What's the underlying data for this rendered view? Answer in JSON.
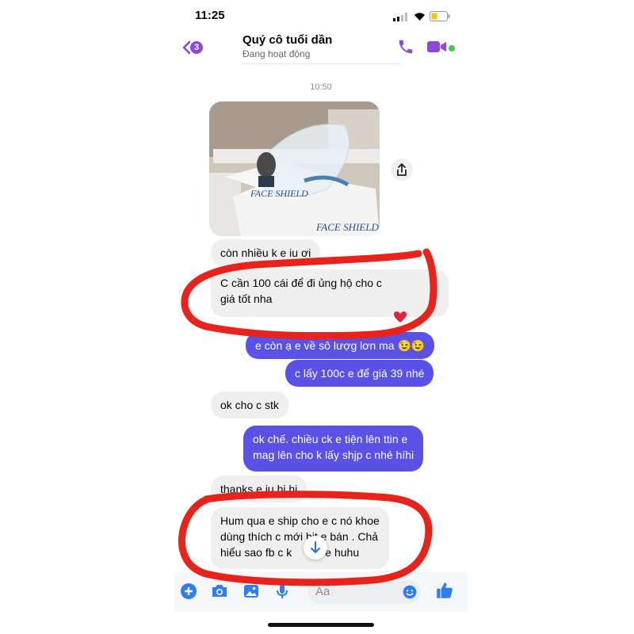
{
  "status_bar": {
    "time": "11:25"
  },
  "header": {
    "back_count": "3",
    "title": "Quý cô tuổi dần",
    "subtitle": "Đang hoạt động"
  },
  "timestamp": "10:50",
  "photo": {
    "caption_lines": [
      "FACE SHIELD",
      "FACE SHIELD"
    ]
  },
  "messages": [
    {
      "side": "in",
      "text": "còn nhiều k e iu ơi"
    },
    {
      "side": "in",
      "lines": [
        "C cần 100 cái để đi ủng hộ cho c",
        "giá tốt nha"
      ],
      "reaction": "heart"
    },
    {
      "side": "out",
      "text": "e còn ạ e về sô lượg lơn ma 😉😉"
    },
    {
      "side": "out",
      "text": "c lấy 100c e để giá 39 nhé"
    },
    {
      "side": "in",
      "text": "ok cho c stk"
    },
    {
      "side": "out",
      "lines": [
        "ok chế. chiều ck e tiện lên ttin e",
        "mag lên cho k lấy shjp c nhé híhi"
      ]
    },
    {
      "side": "in",
      "text": "thanks e iu hi hi"
    },
    {
      "side": "in",
      "lines": [
        "Hum qua e ship cho e c nó khoe",
        "dùng thích c mới bit e bán . Chả",
        "hiểu sao fb c k     bài e huhu"
      ]
    }
  ],
  "composer": {
    "placeholder": "Aa"
  },
  "colors": {
    "accent": "#8e48d6",
    "outgoing_bubble": "#5a51e7",
    "incoming_bubble": "#efefef",
    "annotation": "#e8231c",
    "online": "#44c64b"
  }
}
